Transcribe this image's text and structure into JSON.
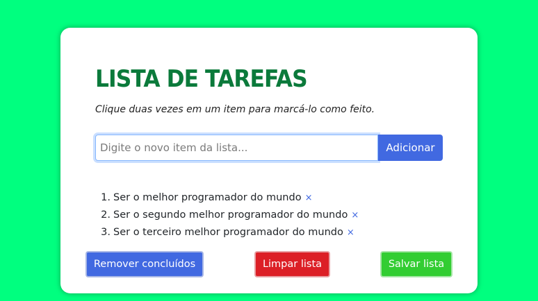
{
  "colors": {
    "page_background": "#00ff7f",
    "title": "#0b7a3b",
    "primary": "#4169e1",
    "danger": "#dc1f26",
    "success": "#32cd32"
  },
  "header": {
    "title": "LISTA DE TAREFAS",
    "subtitle": "Clique duas vezes em um item para marcá-lo como feito."
  },
  "new_task": {
    "placeholder": "Digite o novo item da lista...",
    "value": "",
    "add_label": "Adicionar"
  },
  "tasks": [
    {
      "number": "1.",
      "text": "Ser o melhor programador do mundo",
      "remove": "×"
    },
    {
      "number": "2.",
      "text": "Ser o segundo melhor programador do mundo",
      "remove": "×"
    },
    {
      "number": "3.",
      "text": "Ser o terceiro melhor programador do mundo",
      "remove": "×"
    }
  ],
  "actions": {
    "remove_done_label": "Remover concluídos",
    "clear_label": "Limpar lista",
    "save_label": "Salvar lista"
  }
}
